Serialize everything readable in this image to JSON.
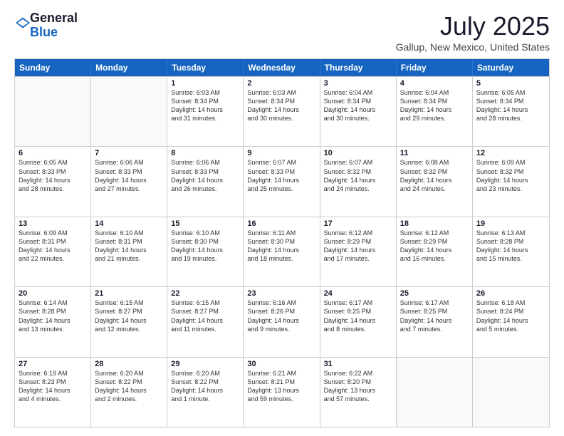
{
  "logo": {
    "general": "General",
    "blue": "Blue"
  },
  "title": "July 2025",
  "location": "Gallup, New Mexico, United States",
  "days": [
    "Sunday",
    "Monday",
    "Tuesday",
    "Wednesday",
    "Thursday",
    "Friday",
    "Saturday"
  ],
  "rows": [
    [
      {
        "day": "",
        "lines": [],
        "empty": true
      },
      {
        "day": "",
        "lines": [],
        "empty": true
      },
      {
        "day": "1",
        "lines": [
          "Sunrise: 6:03 AM",
          "Sunset: 8:34 PM",
          "Daylight: 14 hours",
          "and 31 minutes."
        ]
      },
      {
        "day": "2",
        "lines": [
          "Sunrise: 6:03 AM",
          "Sunset: 8:34 PM",
          "Daylight: 14 hours",
          "and 30 minutes."
        ]
      },
      {
        "day": "3",
        "lines": [
          "Sunrise: 6:04 AM",
          "Sunset: 8:34 PM",
          "Daylight: 14 hours",
          "and 30 minutes."
        ]
      },
      {
        "day": "4",
        "lines": [
          "Sunrise: 6:04 AM",
          "Sunset: 8:34 PM",
          "Daylight: 14 hours",
          "and 29 minutes."
        ]
      },
      {
        "day": "5",
        "lines": [
          "Sunrise: 6:05 AM",
          "Sunset: 8:34 PM",
          "Daylight: 14 hours",
          "and 28 minutes."
        ]
      }
    ],
    [
      {
        "day": "6",
        "lines": [
          "Sunrise: 6:05 AM",
          "Sunset: 8:33 PM",
          "Daylight: 14 hours",
          "and 28 minutes."
        ]
      },
      {
        "day": "7",
        "lines": [
          "Sunrise: 6:06 AM",
          "Sunset: 8:33 PM",
          "Daylight: 14 hours",
          "and 27 minutes."
        ]
      },
      {
        "day": "8",
        "lines": [
          "Sunrise: 6:06 AM",
          "Sunset: 8:33 PM",
          "Daylight: 14 hours",
          "and 26 minutes."
        ]
      },
      {
        "day": "9",
        "lines": [
          "Sunrise: 6:07 AM",
          "Sunset: 8:33 PM",
          "Daylight: 14 hours",
          "and 25 minutes."
        ]
      },
      {
        "day": "10",
        "lines": [
          "Sunrise: 6:07 AM",
          "Sunset: 8:32 PM",
          "Daylight: 14 hours",
          "and 24 minutes."
        ]
      },
      {
        "day": "11",
        "lines": [
          "Sunrise: 6:08 AM",
          "Sunset: 8:32 PM",
          "Daylight: 14 hours",
          "and 24 minutes."
        ]
      },
      {
        "day": "12",
        "lines": [
          "Sunrise: 6:09 AM",
          "Sunset: 8:32 PM",
          "Daylight: 14 hours",
          "and 23 minutes."
        ]
      }
    ],
    [
      {
        "day": "13",
        "lines": [
          "Sunrise: 6:09 AM",
          "Sunset: 8:31 PM",
          "Daylight: 14 hours",
          "and 22 minutes."
        ]
      },
      {
        "day": "14",
        "lines": [
          "Sunrise: 6:10 AM",
          "Sunset: 8:31 PM",
          "Daylight: 14 hours",
          "and 21 minutes."
        ]
      },
      {
        "day": "15",
        "lines": [
          "Sunrise: 6:10 AM",
          "Sunset: 8:30 PM",
          "Daylight: 14 hours",
          "and 19 minutes."
        ]
      },
      {
        "day": "16",
        "lines": [
          "Sunrise: 6:11 AM",
          "Sunset: 8:30 PM",
          "Daylight: 14 hours",
          "and 18 minutes."
        ]
      },
      {
        "day": "17",
        "lines": [
          "Sunrise: 6:12 AM",
          "Sunset: 8:29 PM",
          "Daylight: 14 hours",
          "and 17 minutes."
        ]
      },
      {
        "day": "18",
        "lines": [
          "Sunrise: 6:12 AM",
          "Sunset: 8:29 PM",
          "Daylight: 14 hours",
          "and 16 minutes."
        ]
      },
      {
        "day": "19",
        "lines": [
          "Sunrise: 6:13 AM",
          "Sunset: 8:28 PM",
          "Daylight: 14 hours",
          "and 15 minutes."
        ]
      }
    ],
    [
      {
        "day": "20",
        "lines": [
          "Sunrise: 6:14 AM",
          "Sunset: 8:28 PM",
          "Daylight: 14 hours",
          "and 13 minutes."
        ]
      },
      {
        "day": "21",
        "lines": [
          "Sunrise: 6:15 AM",
          "Sunset: 8:27 PM",
          "Daylight: 14 hours",
          "and 12 minutes."
        ]
      },
      {
        "day": "22",
        "lines": [
          "Sunrise: 6:15 AM",
          "Sunset: 8:27 PM",
          "Daylight: 14 hours",
          "and 11 minutes."
        ]
      },
      {
        "day": "23",
        "lines": [
          "Sunrise: 6:16 AM",
          "Sunset: 8:26 PM",
          "Daylight: 14 hours",
          "and 9 minutes."
        ]
      },
      {
        "day": "24",
        "lines": [
          "Sunrise: 6:17 AM",
          "Sunset: 8:25 PM",
          "Daylight: 14 hours",
          "and 8 minutes."
        ]
      },
      {
        "day": "25",
        "lines": [
          "Sunrise: 6:17 AM",
          "Sunset: 8:25 PM",
          "Daylight: 14 hours",
          "and 7 minutes."
        ]
      },
      {
        "day": "26",
        "lines": [
          "Sunrise: 6:18 AM",
          "Sunset: 8:24 PM",
          "Daylight: 14 hours",
          "and 5 minutes."
        ]
      }
    ],
    [
      {
        "day": "27",
        "lines": [
          "Sunrise: 6:19 AM",
          "Sunset: 8:23 PM",
          "Daylight: 14 hours",
          "and 4 minutes."
        ]
      },
      {
        "day": "28",
        "lines": [
          "Sunrise: 6:20 AM",
          "Sunset: 8:22 PM",
          "Daylight: 14 hours",
          "and 2 minutes."
        ]
      },
      {
        "day": "29",
        "lines": [
          "Sunrise: 6:20 AM",
          "Sunset: 8:22 PM",
          "Daylight: 14 hours",
          "and 1 minute."
        ]
      },
      {
        "day": "30",
        "lines": [
          "Sunrise: 6:21 AM",
          "Sunset: 8:21 PM",
          "Daylight: 13 hours",
          "and 59 minutes."
        ]
      },
      {
        "day": "31",
        "lines": [
          "Sunrise: 6:22 AM",
          "Sunset: 8:20 PM",
          "Daylight: 13 hours",
          "and 57 minutes."
        ]
      },
      {
        "day": "",
        "lines": [],
        "empty": true
      },
      {
        "day": "",
        "lines": [],
        "empty": true
      }
    ]
  ]
}
